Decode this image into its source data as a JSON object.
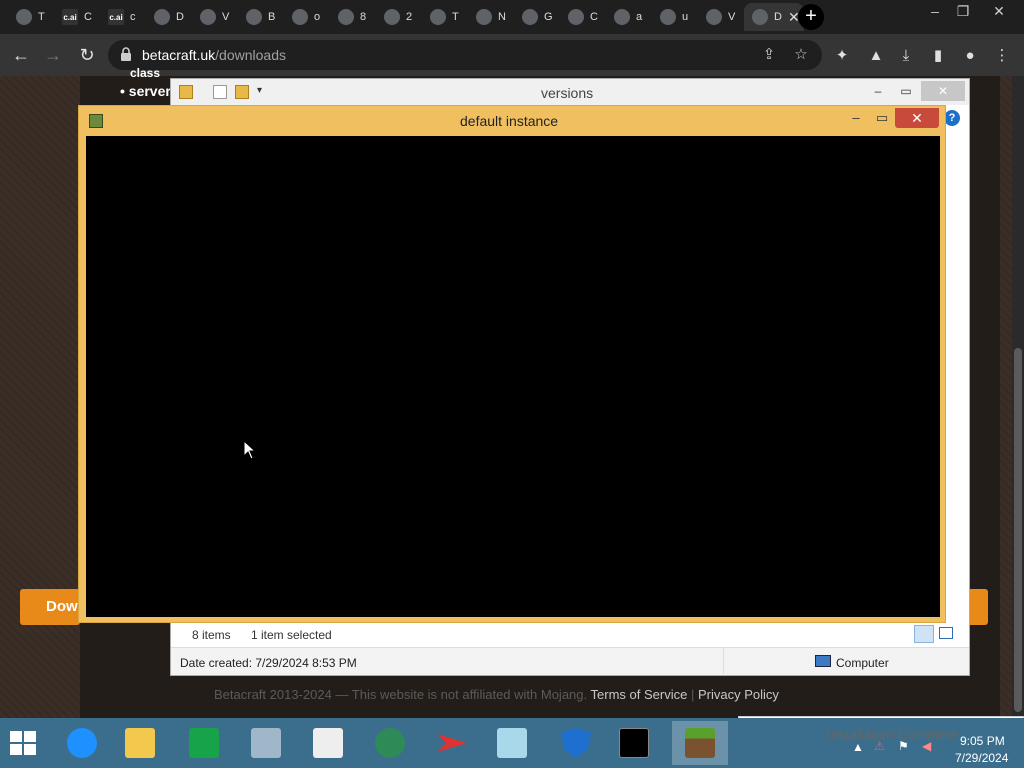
{
  "browser": {
    "tabs": [
      {
        "label": "T",
        "icon": "openai-icon"
      },
      {
        "label": "C",
        "icon": "cai-icon",
        "favtext": "c.ai"
      },
      {
        "label": "c",
        "icon": "cai-icon",
        "favtext": "c.ai"
      },
      {
        "label": "D",
        "icon": "pdf-icon"
      },
      {
        "label": "V",
        "icon": "gmail-icon"
      },
      {
        "label": "B",
        "icon": "globe-icon"
      },
      {
        "label": "o",
        "icon": "globe-icon"
      },
      {
        "label": "8",
        "icon": "badge-icon"
      },
      {
        "label": "2",
        "icon": "cloud-icon"
      },
      {
        "label": "T",
        "icon": "xbox-icon"
      },
      {
        "label": "N",
        "icon": "chrome-icon"
      },
      {
        "label": "G",
        "icon": "nvidia-icon"
      },
      {
        "label": "C",
        "icon": "globe-icon"
      },
      {
        "label": "a",
        "icon": "globe-icon"
      },
      {
        "label": "u",
        "icon": "google-icon"
      },
      {
        "label": "V",
        "icon": "bread-icon"
      },
      {
        "label": "D",
        "icon": "page-icon",
        "active": true
      }
    ],
    "new_tab": "+",
    "url_host": "betacraft.uk",
    "url_path": "/downloads"
  },
  "website": {
    "bullets": [
      "• server",
      "class"
    ],
    "download_label": "Dow",
    "footer_text": "Betacraft 2013-2024 — This website is not affiliated with Mojang.",
    "footer_terms": "Terms of Service",
    "footer_sep": "|",
    "footer_privacy": "Privacy Policy"
  },
  "explorer": {
    "title": "versions",
    "items_count": "8 items",
    "selected": "1 item selected",
    "date_created": "Date created: 7/29/2024 8:53 PM",
    "computer": "Computer",
    "help": "?"
  },
  "game_window": {
    "title": "default instance"
  },
  "taskbar": {
    "apps": [
      "internet-explorer-icon",
      "file-explorer-icon",
      "store-icon",
      "monitor-icon",
      "notepad-icon",
      "globe-update-icon",
      "pdf-arrow-icon",
      "paint-icon",
      "defender-icon",
      "cmd-icon",
      "minecraft-icon"
    ],
    "time": "9:05 PM",
    "date": "7/29/2024",
    "toast": "Installation Complete"
  }
}
